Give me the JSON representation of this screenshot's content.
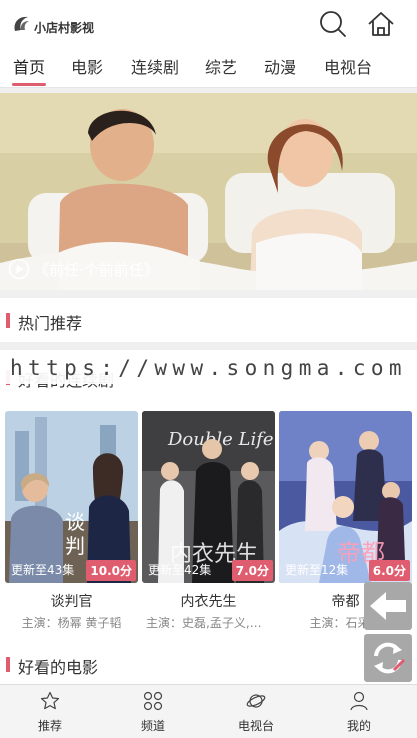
{
  "header": {
    "logo_text": "小店村影视"
  },
  "nav": {
    "items": [
      "首页",
      "电影",
      "连续剧",
      "综艺",
      "动漫",
      "电视台"
    ],
    "active": "首页"
  },
  "banner": {
    "caption": "《前任·个前前任》"
  },
  "sections": {
    "hot": "热门推荐",
    "series": "好看的连续剧",
    "movies": "好看的电影"
  },
  "watermark": "https://www.songma.com",
  "cards": [
    {
      "title": "谈判官",
      "episodes": "更新至43集",
      "score": "10.0分",
      "cast": "主演：杨幂 黄子韬"
    },
    {
      "title": "内衣先生",
      "episodes": "更新至42集",
      "score": "7.0分",
      "cast": "主演：史磊,孟子义,王..."
    },
    {
      "title": "帝都",
      "episodes": "更新至12集",
      "score": "6.0分",
      "cast": "主演：石采言"
    }
  ],
  "tabbar": {
    "items": [
      "推荐",
      "频道",
      "电视台",
      "我的"
    ]
  },
  "colors": {
    "accent": "#e05d6f",
    "float_button": "#a8a8a8"
  }
}
